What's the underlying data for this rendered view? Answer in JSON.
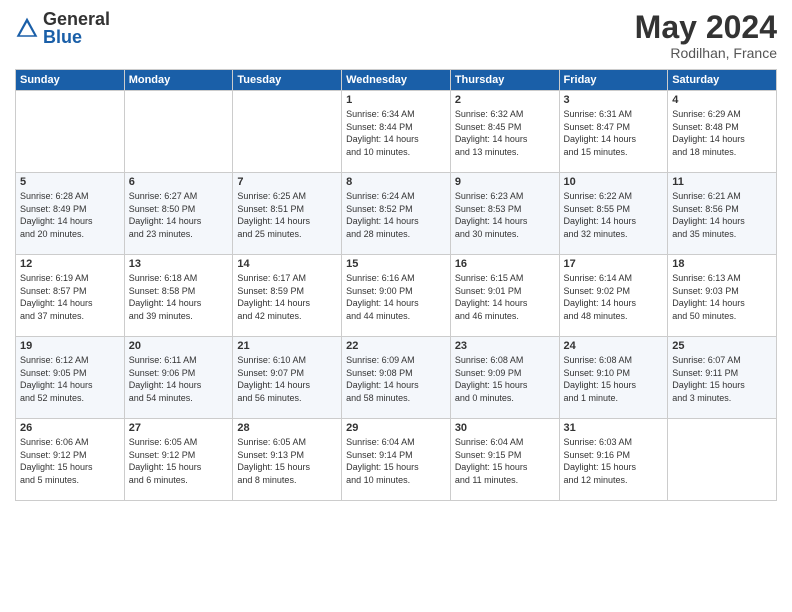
{
  "header": {
    "logo_general": "General",
    "logo_blue": "Blue",
    "month_title": "May 2024",
    "location": "Rodilhan, France"
  },
  "days_of_week": [
    "Sunday",
    "Monday",
    "Tuesday",
    "Wednesday",
    "Thursday",
    "Friday",
    "Saturday"
  ],
  "weeks": [
    [
      {
        "day": "",
        "info": ""
      },
      {
        "day": "",
        "info": ""
      },
      {
        "day": "",
        "info": ""
      },
      {
        "day": "1",
        "info": "Sunrise: 6:34 AM\nSunset: 8:44 PM\nDaylight: 14 hours\nand 10 minutes."
      },
      {
        "day": "2",
        "info": "Sunrise: 6:32 AM\nSunset: 8:45 PM\nDaylight: 14 hours\nand 13 minutes."
      },
      {
        "day": "3",
        "info": "Sunrise: 6:31 AM\nSunset: 8:47 PM\nDaylight: 14 hours\nand 15 minutes."
      },
      {
        "day": "4",
        "info": "Sunrise: 6:29 AM\nSunset: 8:48 PM\nDaylight: 14 hours\nand 18 minutes."
      }
    ],
    [
      {
        "day": "5",
        "info": "Sunrise: 6:28 AM\nSunset: 8:49 PM\nDaylight: 14 hours\nand 20 minutes."
      },
      {
        "day": "6",
        "info": "Sunrise: 6:27 AM\nSunset: 8:50 PM\nDaylight: 14 hours\nand 23 minutes."
      },
      {
        "day": "7",
        "info": "Sunrise: 6:25 AM\nSunset: 8:51 PM\nDaylight: 14 hours\nand 25 minutes."
      },
      {
        "day": "8",
        "info": "Sunrise: 6:24 AM\nSunset: 8:52 PM\nDaylight: 14 hours\nand 28 minutes."
      },
      {
        "day": "9",
        "info": "Sunrise: 6:23 AM\nSunset: 8:53 PM\nDaylight: 14 hours\nand 30 minutes."
      },
      {
        "day": "10",
        "info": "Sunrise: 6:22 AM\nSunset: 8:55 PM\nDaylight: 14 hours\nand 32 minutes."
      },
      {
        "day": "11",
        "info": "Sunrise: 6:21 AM\nSunset: 8:56 PM\nDaylight: 14 hours\nand 35 minutes."
      }
    ],
    [
      {
        "day": "12",
        "info": "Sunrise: 6:19 AM\nSunset: 8:57 PM\nDaylight: 14 hours\nand 37 minutes."
      },
      {
        "day": "13",
        "info": "Sunrise: 6:18 AM\nSunset: 8:58 PM\nDaylight: 14 hours\nand 39 minutes."
      },
      {
        "day": "14",
        "info": "Sunrise: 6:17 AM\nSunset: 8:59 PM\nDaylight: 14 hours\nand 42 minutes."
      },
      {
        "day": "15",
        "info": "Sunrise: 6:16 AM\nSunset: 9:00 PM\nDaylight: 14 hours\nand 44 minutes."
      },
      {
        "day": "16",
        "info": "Sunrise: 6:15 AM\nSunset: 9:01 PM\nDaylight: 14 hours\nand 46 minutes."
      },
      {
        "day": "17",
        "info": "Sunrise: 6:14 AM\nSunset: 9:02 PM\nDaylight: 14 hours\nand 48 minutes."
      },
      {
        "day": "18",
        "info": "Sunrise: 6:13 AM\nSunset: 9:03 PM\nDaylight: 14 hours\nand 50 minutes."
      }
    ],
    [
      {
        "day": "19",
        "info": "Sunrise: 6:12 AM\nSunset: 9:05 PM\nDaylight: 14 hours\nand 52 minutes."
      },
      {
        "day": "20",
        "info": "Sunrise: 6:11 AM\nSunset: 9:06 PM\nDaylight: 14 hours\nand 54 minutes."
      },
      {
        "day": "21",
        "info": "Sunrise: 6:10 AM\nSunset: 9:07 PM\nDaylight: 14 hours\nand 56 minutes."
      },
      {
        "day": "22",
        "info": "Sunrise: 6:09 AM\nSunset: 9:08 PM\nDaylight: 14 hours\nand 58 minutes."
      },
      {
        "day": "23",
        "info": "Sunrise: 6:08 AM\nSunset: 9:09 PM\nDaylight: 15 hours\nand 0 minutes."
      },
      {
        "day": "24",
        "info": "Sunrise: 6:08 AM\nSunset: 9:10 PM\nDaylight: 15 hours\nand 1 minute."
      },
      {
        "day": "25",
        "info": "Sunrise: 6:07 AM\nSunset: 9:11 PM\nDaylight: 15 hours\nand 3 minutes."
      }
    ],
    [
      {
        "day": "26",
        "info": "Sunrise: 6:06 AM\nSunset: 9:12 PM\nDaylight: 15 hours\nand 5 minutes."
      },
      {
        "day": "27",
        "info": "Sunrise: 6:05 AM\nSunset: 9:12 PM\nDaylight: 15 hours\nand 6 minutes."
      },
      {
        "day": "28",
        "info": "Sunrise: 6:05 AM\nSunset: 9:13 PM\nDaylight: 15 hours\nand 8 minutes."
      },
      {
        "day": "29",
        "info": "Sunrise: 6:04 AM\nSunset: 9:14 PM\nDaylight: 15 hours\nand 10 minutes."
      },
      {
        "day": "30",
        "info": "Sunrise: 6:04 AM\nSunset: 9:15 PM\nDaylight: 15 hours\nand 11 minutes."
      },
      {
        "day": "31",
        "info": "Sunrise: 6:03 AM\nSunset: 9:16 PM\nDaylight: 15 hours\nand 12 minutes."
      },
      {
        "day": "",
        "info": ""
      }
    ]
  ]
}
